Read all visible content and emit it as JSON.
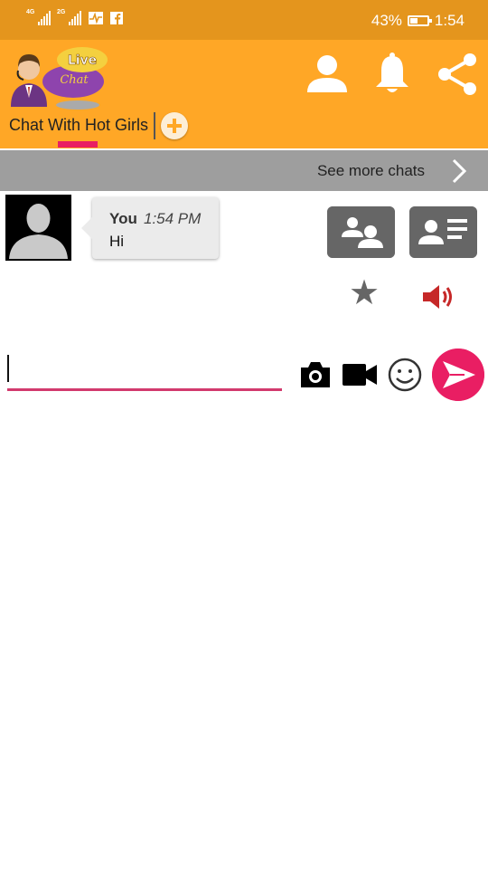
{
  "status_bar": {
    "signal_1_tag": "4G",
    "signal_2_tag": "2G",
    "battery_percent": "43%",
    "battery_level": 0.43,
    "time": "1:54",
    "notification_icons": [
      "activity-icon",
      "facebook-icon"
    ]
  },
  "app_bar": {
    "logo_line1": "Live",
    "logo_line2": "Chat",
    "actions": [
      "profile-icon",
      "bell-icon",
      "share-icon"
    ],
    "tab_title": "Chat With Hot Girls",
    "accent_color": "#e91e63",
    "bar_color": "#ffa726",
    "status_color": "#e4951d"
  },
  "more_bar": {
    "label": "See more chats"
  },
  "message": {
    "sender": "You",
    "time": "1:54 PM",
    "text": "Hi"
  },
  "composer": {
    "value": "",
    "placeholder": ""
  }
}
